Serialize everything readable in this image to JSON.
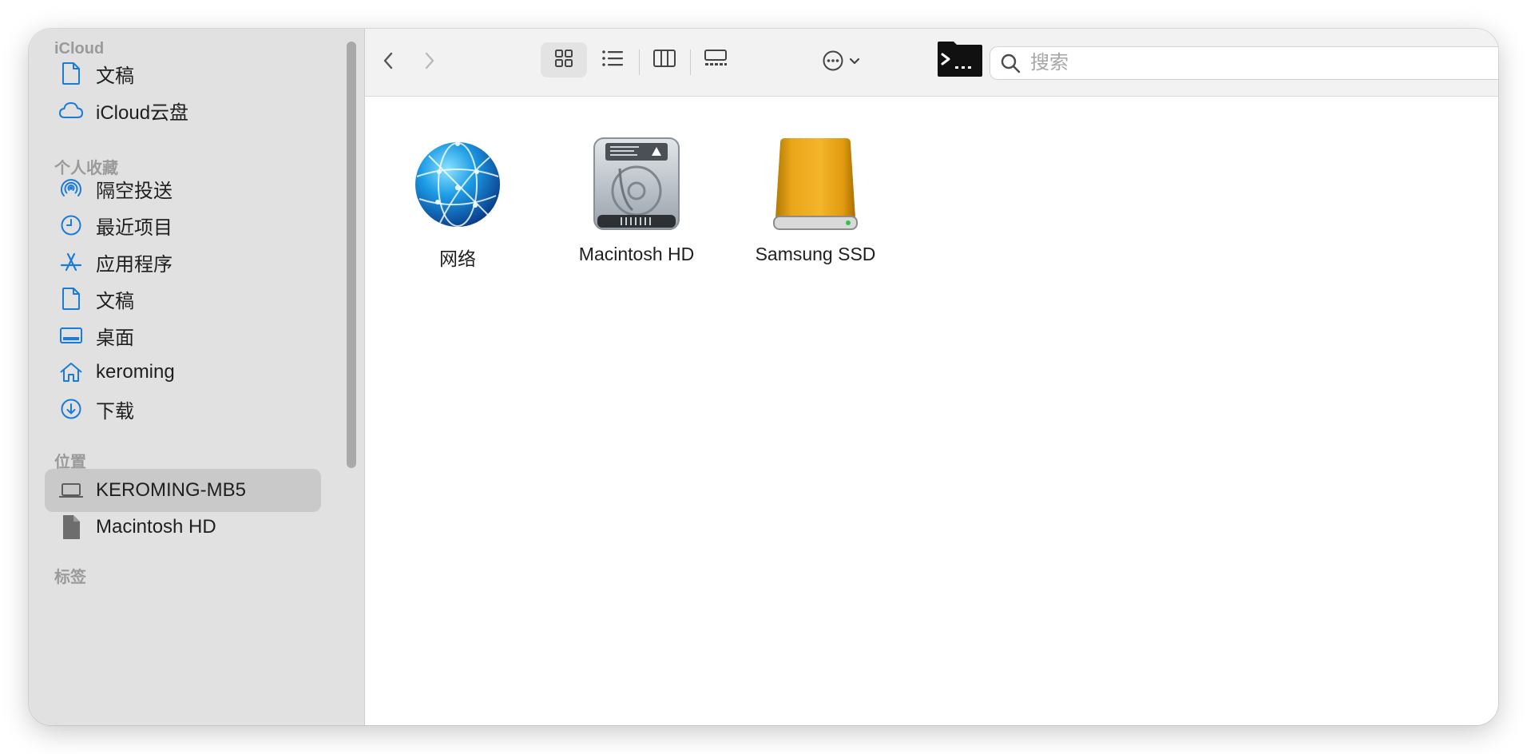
{
  "sidebar": {
    "sections": {
      "icloud": "iCloud",
      "favorites": "个人收藏",
      "locations": "位置",
      "tags": "标签"
    },
    "icloud_items": [
      {
        "label": "文稿",
        "icon": "document-icon"
      },
      {
        "label": "iCloud云盘",
        "icon": "cloud-icon"
      }
    ],
    "favorite_items": [
      {
        "label": "隔空投送",
        "icon": "airdrop-icon"
      },
      {
        "label": "最近项目",
        "icon": "clock-icon"
      },
      {
        "label": "应用程序",
        "icon": "applications-icon"
      },
      {
        "label": "文稿",
        "icon": "document-icon"
      },
      {
        "label": "桌面",
        "icon": "desktop-icon"
      },
      {
        "label": "keroming",
        "icon": "home-icon"
      },
      {
        "label": "下载",
        "icon": "download-icon"
      }
    ],
    "location_items": [
      {
        "label": "KEROMING-MB5",
        "icon": "laptop-icon",
        "selected": true
      },
      {
        "label": "Macintosh HD",
        "icon": "file-icon",
        "selected": false
      }
    ]
  },
  "toolbar": {
    "search_placeholder": "搜索",
    "active_view": "icon-view",
    "accent_color": "#1a7bd9"
  },
  "content": {
    "items": [
      {
        "label": "网络",
        "icon": "network-globe-icon"
      },
      {
        "label": "Macintosh HD",
        "icon": "hard-drive-icon"
      },
      {
        "label": "Samsung SSD",
        "icon": "external-ssd-icon"
      }
    ]
  }
}
